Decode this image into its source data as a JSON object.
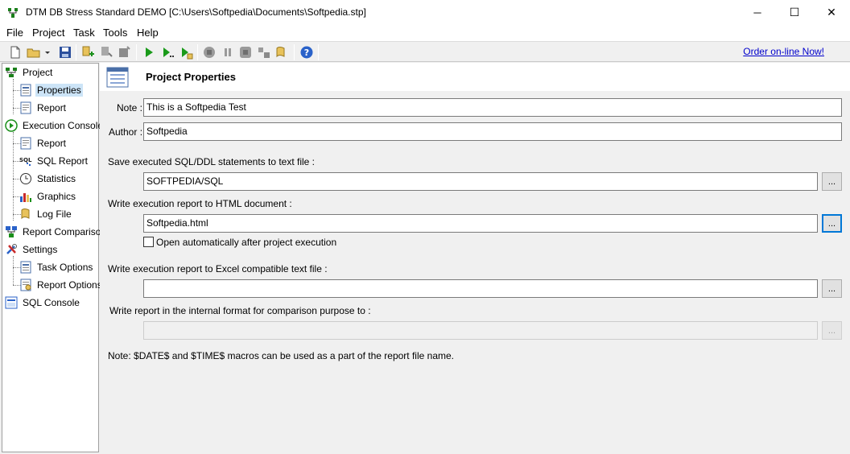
{
  "window": {
    "title": "DTM DB Stress Standard DEMO [C:\\Users\\Softpedia\\Documents\\Softpedia.stp]",
    "app_icon": "tree-icon",
    "controls": {
      "minimize": "─",
      "maximize": "☐",
      "close": "✕"
    }
  },
  "menu": [
    "File",
    "Project",
    "Task",
    "Tools",
    "Help"
  ],
  "toolbar": {
    "order_link": "Order on-line Now!",
    "icons": [
      "new-file-icon",
      "open-folder-icon",
      "dropdown-arrow-icon",
      "save-icon",
      "add-task-icon",
      "edit-task-icon",
      "delete-task-icon",
      "run-icon",
      "run-step-icon",
      "run-script-icon",
      "stop-icon",
      "pause-icon",
      "stop-all-icon",
      "report-icon",
      "log-icon",
      "help-icon"
    ]
  },
  "tree": {
    "project": "Project",
    "properties": "Properties",
    "report": "Report",
    "execution_console": "Execution Console",
    "exec_report": "Report",
    "sql_report": "SQL Report",
    "statistics": "Statistics",
    "graphics": "Graphics",
    "log_file": "Log File",
    "report_comparison": "Report Comparison",
    "settings": "Settings",
    "task_options": "Task Options",
    "report_options": "Report Options",
    "sql_console": "SQL Console"
  },
  "panel": {
    "title": "Project Properties",
    "note_label": "Note :",
    "note_value": "This is a Softpedia Test",
    "author_label": "Author :",
    "author_value": "Softpedia",
    "sql_label": "Save executed SQL/DDL statements to text file :",
    "sql_value": "SOFTPEDIA/SQL",
    "html_label": "Write execution report to HTML document :",
    "html_value": "Softpedia.html",
    "open_auto_label": "Open automatically after project execution",
    "excel_label": "Write execution report to Excel compatible text file :",
    "excel_value": "",
    "internal_label": "Write report in the internal format for comparison purpose to :",
    "internal_value": "",
    "browse": "...",
    "note_text": "Note: $DATE$ and $TIME$ macros can be used as a part of the report file name."
  },
  "colors": {
    "link": "#0000cc",
    "selection": "#cce4f7",
    "focus": "#0078d7"
  }
}
